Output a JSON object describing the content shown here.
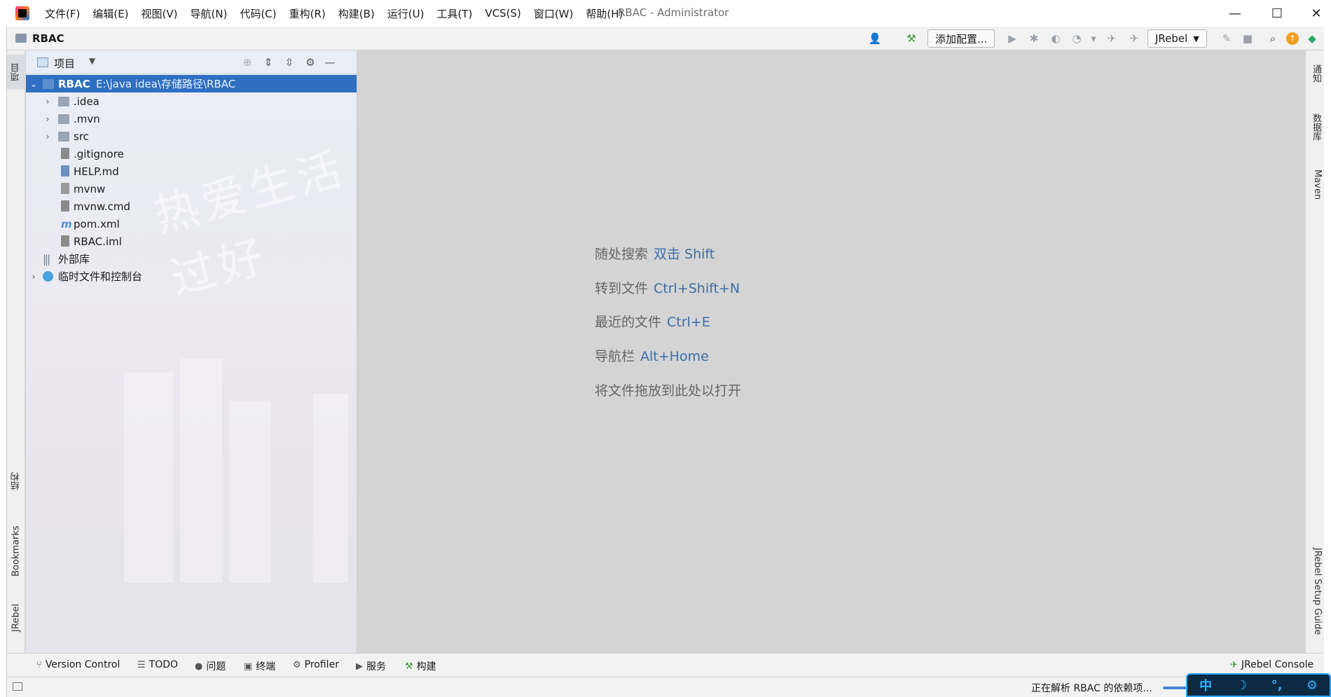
{
  "window": {
    "title": "RBAC - Administrator",
    "minimize_glyph": "—",
    "maximize_glyph": "☐",
    "close_glyph": "✕"
  },
  "menu": [
    "文件(F)",
    "编辑(E)",
    "视图(V)",
    "导航(N)",
    "代码(C)",
    "重构(R)",
    "构建(B)",
    "运行(U)",
    "工具(T)",
    "VCS(S)",
    "窗口(W)",
    "帮助(H)"
  ],
  "navbar": {
    "project_name": "RBAC",
    "add_config_label": "添加配置...",
    "jrebel_label": "JRebel",
    "jrebel_caret": "▼"
  },
  "left_strip": {
    "project_tab": "项目",
    "structure_tab": "结构",
    "bookmarks_tab": "Bookmarks",
    "jrebel_tab": "JRebel"
  },
  "right_strip": {
    "notifications_tab": "通知",
    "database_tab": "数据库",
    "maven_tab": "Maven",
    "jrebel_guide_tab": "JRebel Setup Guide"
  },
  "project_panel": {
    "title": "项目",
    "caret": "▼",
    "watermark": "热爱生活 过好",
    "tree": [
      {
        "label": "RBAC",
        "path": "E:\\java idea\\存储路径\\RBAC",
        "expanded": true,
        "selected": true,
        "icon": "module-folder-icon"
      },
      {
        "label": ".idea",
        "icon": "folder-icon",
        "expandable": true
      },
      {
        "label": ".mvn",
        "icon": "folder-icon",
        "expandable": true
      },
      {
        "label": "src",
        "icon": "folder-icon",
        "expandable": true
      },
      {
        "label": ".gitignore",
        "icon": "gitignore-file-icon"
      },
      {
        "label": "HELP.md",
        "icon": "markdown-file-icon"
      },
      {
        "label": "mvnw",
        "icon": "shell-file-icon"
      },
      {
        "label": "mvnw.cmd",
        "icon": "text-file-icon"
      },
      {
        "label": "pom.xml",
        "icon": "maven-file-icon"
      },
      {
        "label": "RBAC.iml",
        "icon": "iml-file-icon"
      },
      {
        "label": "外部库",
        "icon": "library-icon"
      },
      {
        "label": "临时文件和控制台",
        "icon": "scratch-icon",
        "expandable": true
      }
    ]
  },
  "editor_hints": [
    {
      "text": "随处搜索",
      "key": "双击 Shift"
    },
    {
      "text": "转到文件",
      "key": "Ctrl+Shift+N"
    },
    {
      "text": "最近的文件",
      "key": "Ctrl+E"
    },
    {
      "text": "导航栏",
      "key": "Alt+Home"
    },
    {
      "text": "将文件拖放到此处以打开",
      "key": ""
    }
  ],
  "bottom_tools": [
    {
      "label": "Version Control",
      "icon": "version-control-icon",
      "glyph": "⑂"
    },
    {
      "label": "TODO",
      "icon": "todo-icon",
      "glyph": "☰"
    },
    {
      "label": "问题",
      "icon": "problems-icon",
      "glyph": "●"
    },
    {
      "label": "终端",
      "icon": "terminal-icon",
      "glyph": "▣"
    },
    {
      "label": "Profiler",
      "icon": "profiler-icon",
      "glyph": "⚙"
    },
    {
      "label": "服务",
      "icon": "services-icon",
      "glyph": "▶"
    },
    {
      "label": "构建",
      "icon": "build-icon",
      "glyph": "⚒"
    }
  ],
  "jrebel_console": "JRebel Console",
  "status": {
    "text": "正在解析 RBAC 的依赖项...",
    "ime": [
      "中",
      "☽",
      "°,",
      "⚙"
    ]
  },
  "colors": {
    "selection": "#2e6fc2",
    "hint_key": "#3a6da8"
  }
}
